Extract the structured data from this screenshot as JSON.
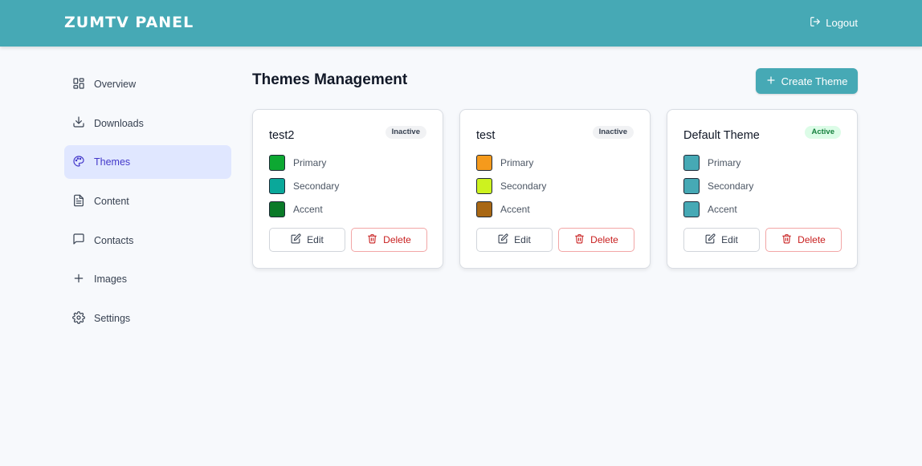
{
  "header": {
    "brand": "ZUMTV PANEL",
    "logout_label": "Logout"
  },
  "sidebar": {
    "items": [
      {
        "label": "Overview",
        "icon": "grid-icon",
        "active": false
      },
      {
        "label": "Downloads",
        "icon": "download-icon",
        "active": false
      },
      {
        "label": "Themes",
        "icon": "palette-icon",
        "active": true
      },
      {
        "label": "Content",
        "icon": "file-text-icon",
        "active": false
      },
      {
        "label": "Contacts",
        "icon": "message-icon",
        "active": false
      },
      {
        "label": "Images",
        "icon": "plus-icon",
        "active": false
      },
      {
        "label": "Settings",
        "icon": "gear-icon",
        "active": false
      }
    ]
  },
  "main": {
    "title": "Themes Management",
    "create_label": "Create Theme",
    "themes": [
      {
        "name": "test2",
        "status": "Inactive",
        "colors": [
          {
            "label": "Primary",
            "hex": "#0da832"
          },
          {
            "label": "Secondary",
            "hex": "#0aa89a"
          },
          {
            "label": "Accent",
            "hex": "#0a7a28"
          }
        ],
        "edit_label": "Edit",
        "delete_label": "Delete"
      },
      {
        "name": "test",
        "status": "Inactive",
        "colors": [
          {
            "label": "Primary",
            "hex": "#f59a1c"
          },
          {
            "label": "Secondary",
            "hex": "#cdf21f"
          },
          {
            "label": "Accent",
            "hex": "#a86714"
          }
        ],
        "edit_label": "Edit",
        "delete_label": "Delete"
      },
      {
        "name": "Default Theme",
        "status": "Active",
        "colors": [
          {
            "label": "Primary",
            "hex": "#46a9b5"
          },
          {
            "label": "Secondary",
            "hex": "#46a9b5"
          },
          {
            "label": "Accent",
            "hex": "#46a9b5"
          }
        ],
        "edit_label": "Edit",
        "delete_label": "Delete"
      }
    ]
  },
  "colors": {
    "accent": "#46a9b5",
    "active_nav_bg": "#e0e7ff",
    "danger": "#c81e1e"
  }
}
